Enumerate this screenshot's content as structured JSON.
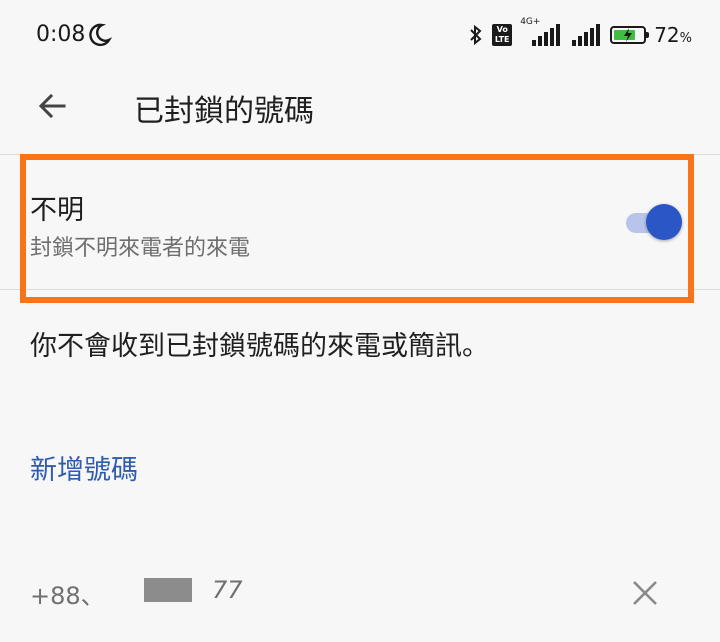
{
  "status": {
    "time": "0:08",
    "network_label": "4G+",
    "volte_top": "Vo",
    "volte_bottom": "LTE",
    "battery_percent": "72",
    "battery_unit": "%",
    "battery_level": 0.72,
    "icons": [
      "moon-icon",
      "bluetooth-icon",
      "volte-icon",
      "signal-icon",
      "signal-icon",
      "battery-charging-icon"
    ]
  },
  "appbar": {
    "title": "已封鎖的號碼",
    "back_icon": "arrow-back-icon"
  },
  "unknown_row": {
    "title": "不明",
    "subtitle": "封鎖不明來電者的來電",
    "toggle_on": true
  },
  "info_text": "你不會收到已封鎖號碼的來電或簡訊。",
  "add_number_label": "新增號碼",
  "blocked_number": {
    "prefix": "+88、",
    "suffix": "77",
    "remove_icon": "close-icon"
  },
  "colors": {
    "highlight": "#f97319",
    "accent": "#2a56c6",
    "link": "#2f5cae",
    "background": "#f7f7f7"
  }
}
